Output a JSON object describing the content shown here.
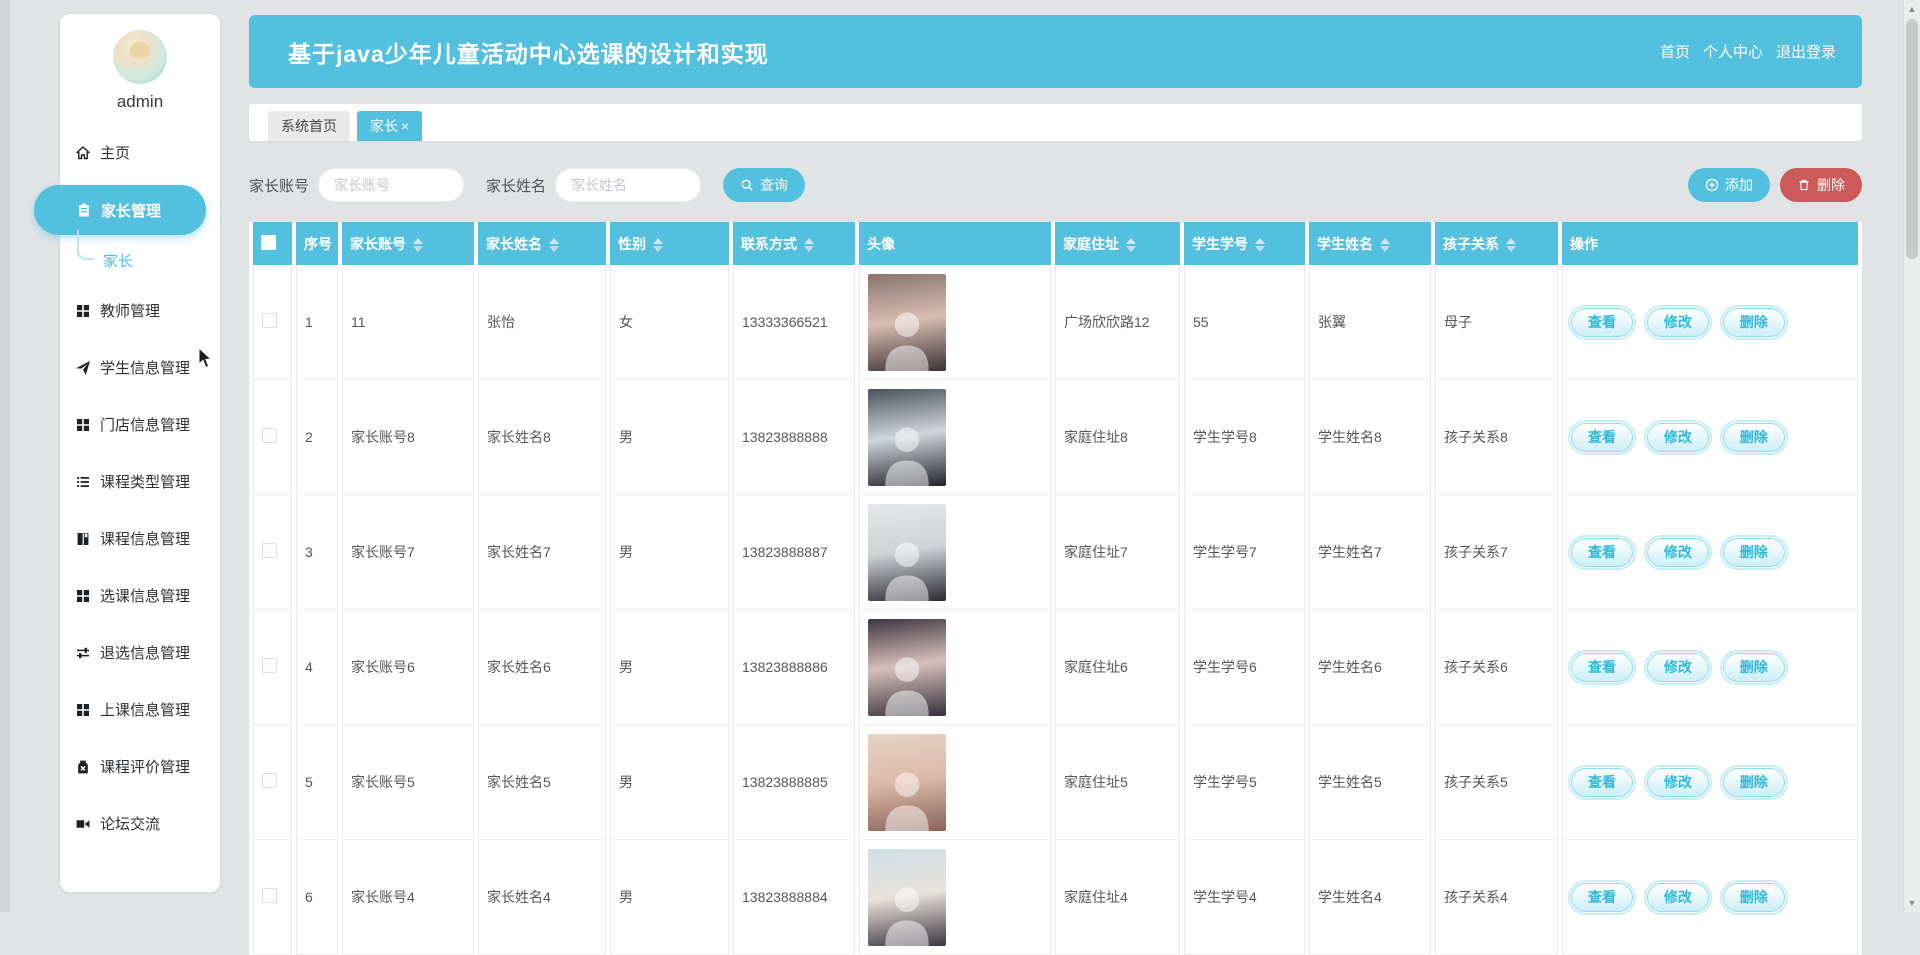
{
  "app": {
    "title": "基于java少年儿童活动中心选课的设计和实现"
  },
  "header": {
    "nav": [
      "首页",
      "个人中心",
      "退出登录"
    ]
  },
  "sidebar": {
    "username": "admin",
    "items": [
      {
        "label": "主页"
      },
      {
        "label": "家长管理",
        "active": true
      },
      {
        "label": "教师管理"
      },
      {
        "label": "学生信息管理"
      },
      {
        "label": "门店信息管理"
      },
      {
        "label": "课程类型管理"
      },
      {
        "label": "课程信息管理"
      },
      {
        "label": "选课信息管理"
      },
      {
        "label": "退选信息管理"
      },
      {
        "label": "上课信息管理"
      },
      {
        "label": "课程评价管理"
      },
      {
        "label": "论坛交流"
      }
    ],
    "submenu_label": "家长"
  },
  "tabs": [
    {
      "label": "系统首页"
    },
    {
      "label": "家长",
      "close": "×"
    }
  ],
  "search": {
    "account_label": "家长账号",
    "account_placeholder": "家长账号",
    "name_label": "家长姓名",
    "name_placeholder": "家长姓名",
    "query_label": "查询"
  },
  "toolbar": {
    "add_label": "添加",
    "delete_label": "删除"
  },
  "table": {
    "columns": [
      "序号",
      "家长账号",
      "家长姓名",
      "性别",
      "联系方式",
      "头像",
      "家庭住址",
      "学生学号",
      "学生姓名",
      "孩子关系",
      "操作"
    ],
    "actions": [
      "查看",
      "修改",
      "删除"
    ],
    "rows": [
      {
        "no": "1",
        "account": "11",
        "name": "张怡",
        "gender": "女",
        "phone": "13333366521",
        "address": "广场欣欣路12",
        "student_no": "55",
        "student_name": "张翼",
        "relation": "母子",
        "avatar_tone": {
          "top": "#8a7470",
          "mid": "#d9bdb2",
          "bottom": "#3b3134"
        }
      },
      {
        "no": "2",
        "account": "家长账号8",
        "name": "家长姓名8",
        "gender": "男",
        "phone": "13823888888",
        "address": "家庭住址8",
        "student_no": "学生学号8",
        "student_name": "学生姓名8",
        "relation": "孩子关系8",
        "avatar_tone": {
          "top": "#49535c",
          "mid": "#cfd6da",
          "bottom": "#23242a"
        }
      },
      {
        "no": "3",
        "account": "家长账号7",
        "name": "家长姓名7",
        "gender": "男",
        "phone": "13823888887",
        "address": "家庭住址7",
        "student_no": "学生学号7",
        "student_name": "学生姓名7",
        "relation": "孩子关系7",
        "avatar_tone": {
          "top": "#e6e8ea",
          "mid": "#cfd2d6",
          "bottom": "#2a2a30"
        }
      },
      {
        "no": "4",
        "account": "家长账号6",
        "name": "家长姓名6",
        "gender": "男",
        "phone": "13823888886",
        "address": "家庭住址6",
        "student_no": "学生学号6",
        "student_name": "学生姓名6",
        "relation": "孩子关系6",
        "avatar_tone": {
          "top": "#3f3640",
          "mid": "#d8c0bc",
          "bottom": "#35303a"
        }
      },
      {
        "no": "5",
        "account": "家长账号5",
        "name": "家长姓名5",
        "gender": "男",
        "phone": "13823888885",
        "address": "家庭住址5",
        "student_no": "学生学号5",
        "student_name": "学生姓名5",
        "relation": "孩子关系5",
        "avatar_tone": {
          "top": "#e8d4c6",
          "mid": "#dcb9a8",
          "bottom": "#8a6458"
        }
      },
      {
        "no": "6",
        "account": "家长账号4",
        "name": "家长姓名4",
        "gender": "男",
        "phone": "13823888884",
        "address": "家庭住址4",
        "student_no": "学生学号4",
        "student_name": "学生姓名4",
        "relation": "孩子关系4",
        "avatar_tone": {
          "top": "#cfdfe8",
          "mid": "#e8e2da",
          "bottom": "#3c3642"
        }
      }
    ]
  },
  "colors": {
    "primary": "#53c0df",
    "danger": "#cd5a5a"
  }
}
